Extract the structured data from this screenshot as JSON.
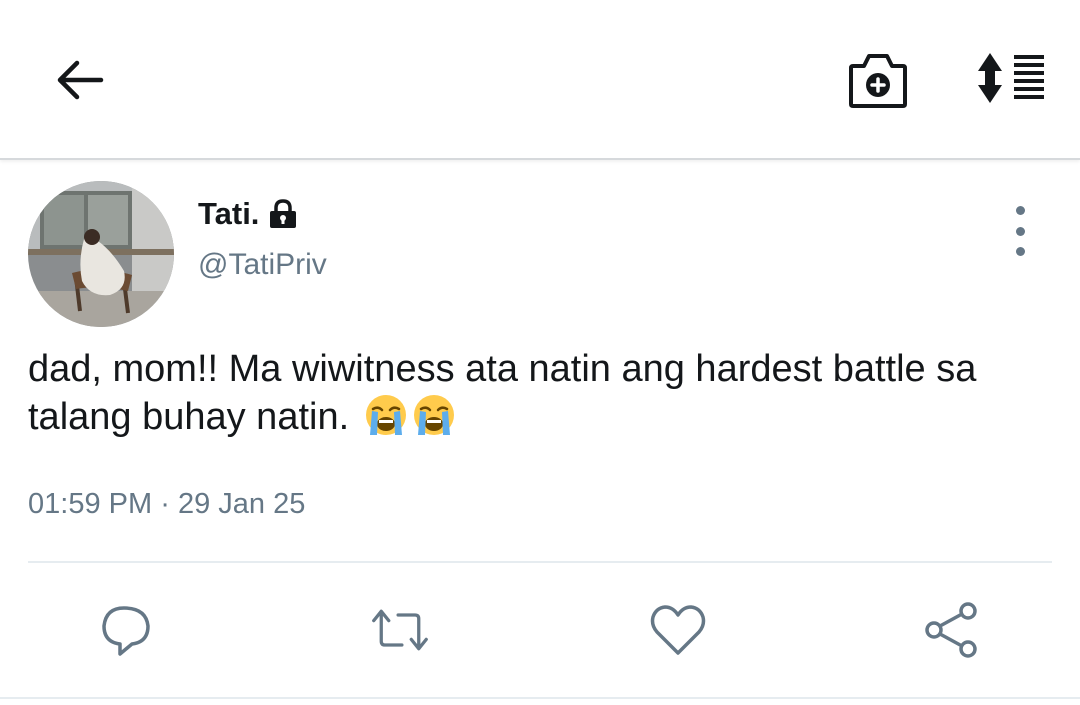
{
  "toolbar": {
    "back_icon": "arrow-left-icon",
    "camera_icon": "camera-plus-icon",
    "sort_icon": "sort-list-icon"
  },
  "tweet": {
    "display_name": "Tati.",
    "protected_icon": "lock-icon",
    "handle": "@TatiPriv",
    "text": "dad, mom!! Ma wiwitness ata natin ang hardest battle sa talang buhay natin.",
    "emojis": [
      "loudly-crying-face",
      "loudly-crying-face"
    ],
    "time": "01:59 PM",
    "separator": "·",
    "date": "29 Jan 25"
  },
  "actions": {
    "reply_icon": "reply-icon",
    "retweet_icon": "retweet-icon",
    "like_icon": "heart-icon",
    "share_icon": "share-icon"
  },
  "colors": {
    "text": "#14171a",
    "secondary": "#657786",
    "divider": "#e6ecf0"
  }
}
